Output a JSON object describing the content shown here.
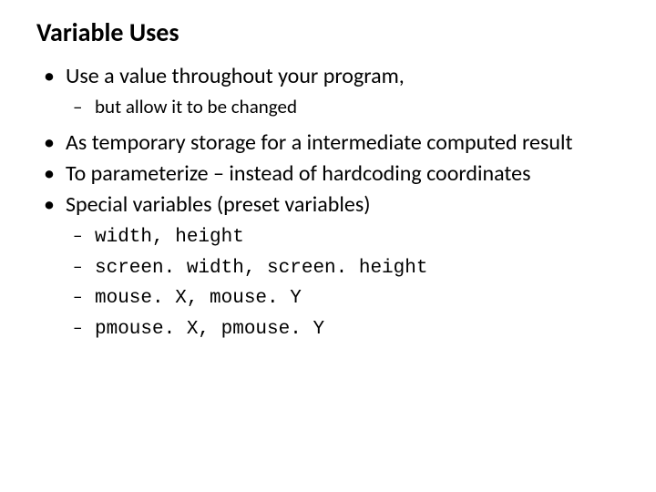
{
  "title": "Variable Uses",
  "bullets": {
    "b0": "Use a value throughout your program,",
    "b0_sub0": "but allow it to be changed",
    "b1": "As temporary storage for a intermediate computed result",
    "b2": "To parameterize – instead of hardcoding coordinates",
    "b3": "Special variables (preset variables)",
    "b3_sub0": "width, height",
    "b3_sub1": "screen. width, screen. height",
    "b3_sub2": "mouse. X, mouse. Y",
    "b3_sub3": "pmouse. X, pmouse. Y"
  }
}
